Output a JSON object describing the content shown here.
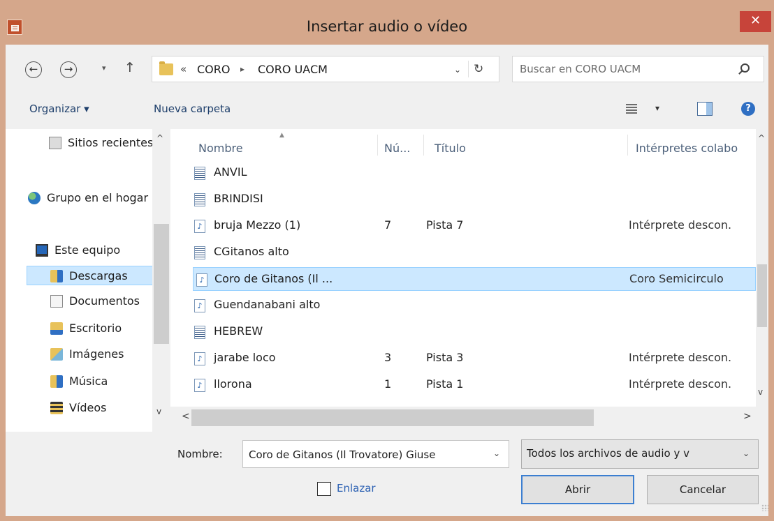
{
  "window": {
    "title": "Insertar audio o vídeo",
    "close_label": "✕"
  },
  "nav": {
    "back": "←",
    "forward": "→",
    "dropdown": "▾",
    "up": "↑",
    "overflow": "«",
    "breadcrumb": [
      "CORO",
      "CORO UACM"
    ],
    "separator": "▸",
    "address_dropdown": "⌄",
    "refresh": "↻",
    "search_placeholder": "Buscar en CORO UACM"
  },
  "toolbar": {
    "organize": "Organizar ▾",
    "new_folder": "Nueva carpeta",
    "view_dropdown": "▾",
    "help": "?"
  },
  "sidebar": {
    "items": [
      {
        "label": "Sitios recientes",
        "icon": "recent-places-icon"
      },
      {
        "label": "Grupo en el hogar",
        "icon": "homegroup-icon"
      },
      {
        "label": "Este equipo",
        "icon": "computer-icon"
      },
      {
        "label": "Descargas",
        "icon": "downloads-folder-icon",
        "selected": true
      },
      {
        "label": "Documentos",
        "icon": "documents-folder-icon"
      },
      {
        "label": "Escritorio",
        "icon": "desktop-folder-icon"
      },
      {
        "label": "Imágenes",
        "icon": "pictures-folder-icon"
      },
      {
        "label": "Música",
        "icon": "music-folder-icon"
      },
      {
        "label": "Vídeos",
        "icon": "videos-folder-icon"
      }
    ],
    "scroll_up": "^",
    "scroll_down": "v"
  },
  "columns": {
    "name": "Nombre",
    "number": "Nú...",
    "title": "Título",
    "performers": "Intérpretes colabo"
  },
  "files": [
    {
      "name": "ANVIL",
      "number": "",
      "title": "",
      "performers": "",
      "type": "playlist"
    },
    {
      "name": "BRINDISI",
      "number": "",
      "title": "",
      "performers": "",
      "type": "playlist"
    },
    {
      "name": "bruja Mezzo (1)",
      "number": "7",
      "title": "Pista 7",
      "performers": "Intérprete descon.",
      "type": "audio"
    },
    {
      "name": "CGitanos alto",
      "number": "",
      "title": "",
      "performers": "",
      "type": "playlist"
    },
    {
      "name": "Coro de Gitanos (Il ...",
      "number": "",
      "title": "",
      "performers": "Coro Semicirculo",
      "type": "audio",
      "selected": true
    },
    {
      "name": "Guendanabani alto",
      "number": "",
      "title": "",
      "performers": "",
      "type": "audio"
    },
    {
      "name": "HEBREW",
      "number": "",
      "title": "",
      "performers": "",
      "type": "playlist"
    },
    {
      "name": "jarabe loco",
      "number": "3",
      "title": "Pista 3",
      "performers": "Intérprete descon.",
      "type": "audio"
    },
    {
      "name": "llorona",
      "number": "1",
      "title": "Pista 1",
      "performers": "Intérprete descon.",
      "type": "audio"
    }
  ],
  "list_scroll": {
    "up": "^",
    "down": "v",
    "left": "<",
    "right": ">"
  },
  "footer": {
    "filename_label": "Nombre:",
    "filename_value": "Coro de Gitanos (Il Trovatore) Giuse",
    "filename_dropdown": "⌄",
    "filter_value": "Todos los archivos de audio y v",
    "filter_dropdown": "⌄",
    "link_label": "Enlazar",
    "link_checked": false,
    "open_label": "Abrir",
    "cancel_label": "Cancelar"
  }
}
